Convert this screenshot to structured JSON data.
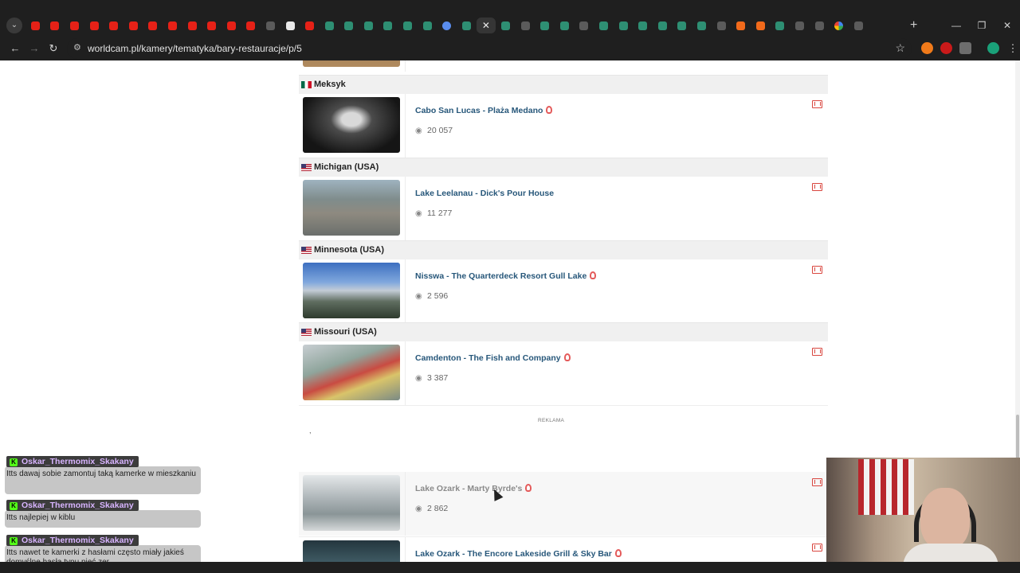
{
  "browser": {
    "url": "worldcam.pl/kamery/tematyka/bary-restauracje/p/5",
    "tab_favicons": [
      "yt",
      "yt",
      "yt",
      "yt",
      "yt",
      "yt",
      "yt",
      "yt",
      "yt",
      "yt",
      "yt",
      "yt",
      "dk",
      "wh",
      "yt",
      "gr",
      "gr",
      "gr",
      "gr",
      "gr",
      "gr",
      "bl",
      "gr",
      "active",
      "gr",
      "dk",
      "gr",
      "gr",
      "dk",
      "gr",
      "gr",
      "gr",
      "gr",
      "gr",
      "gr",
      "dk",
      "or",
      "or",
      "gr",
      "dk",
      "dk",
      "gl",
      "dk"
    ],
    "new_tab_symbol": "+",
    "close_tab_symbol": "✕",
    "back_symbol": "←",
    "forward_symbol": "→",
    "reload_symbol": "↻",
    "star_symbol": "☆"
  },
  "listing": {
    "ad_label": "REKLAMA",
    "ad_mark": ",",
    "groups": [
      {
        "name": "Meksyk",
        "flag": "mx"
      },
      {
        "name": "Michigan (USA)",
        "flag": "us"
      },
      {
        "name": "Minnesota (USA)",
        "flag": "us"
      },
      {
        "name": "Missouri (USA)",
        "flag": "us"
      }
    ],
    "cams": [
      {
        "title": "Cabo San Lucas - Plaża Medano",
        "views": "20 057",
        "badge": true
      },
      {
        "title": "Lake Leelanau - Dick's Pour House",
        "views": "11 277",
        "badge": false
      },
      {
        "title": "Nisswa - The Quarterdeck Resort Gull Lake",
        "views": "2 596",
        "badge": true
      },
      {
        "title": "Camdenton - The Fish and Company",
        "views": "3 387",
        "badge": true
      },
      {
        "title": "Lake Ozark - Marty Byrde's",
        "views": "2 862",
        "badge": true
      },
      {
        "title": "Lake Ozark - The Encore Lakeside Grill & Sky Bar",
        "views": "",
        "badge": true
      }
    ]
  },
  "chat": [
    {
      "user": "Oskar_Thermomix_Skakany",
      "message": "Itts dawaj sobie zamontuj taką kamerke w mieszkaniu"
    },
    {
      "user": "Oskar_Thermomix_Skakany",
      "message": "Itts najlepiej w kiblu"
    },
    {
      "user": "Oskar_Thermomix_Skakany",
      "message": "Itts nawet te kamerki z hasłami często miały jakieś domyślne hasła typu pięć zer"
    }
  ],
  "colors": {
    "link": "#27577a",
    "accent_red": "#d9463f",
    "group_bg": "#f0f0f0",
    "chrome_bg": "#1f1f1f"
  }
}
